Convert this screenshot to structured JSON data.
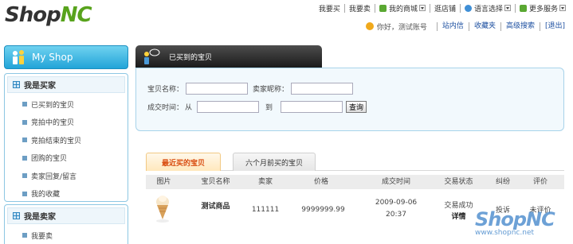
{
  "header": {
    "logo_shop": "Shop",
    "logo_nc": "NC",
    "topnav": [
      {
        "label": "我要买"
      },
      {
        "label": "我要卖"
      },
      {
        "label": "我的商城"
      },
      {
        "label": "逛店铺"
      },
      {
        "label": "语言选择"
      },
      {
        "label": "更多服务"
      }
    ],
    "greeting": "你好，测试账号",
    "links": [
      "站内信",
      "收藏夹",
      "高级搜索",
      "[退出]"
    ]
  },
  "sidebar": {
    "title": "My Shop",
    "buyer": {
      "heading": "我是买家",
      "items": [
        "已买到的宝贝",
        "竞拍中的宝贝",
        "竞拍结束的宝贝",
        "团购的宝贝",
        "卖家回复/留言",
        "我的收藏"
      ]
    },
    "seller": {
      "heading": "我是卖家",
      "items": [
        "我要卖"
      ]
    }
  },
  "main": {
    "title": "已买到的宝贝",
    "search": {
      "item_name_label": "宝贝名称：",
      "seller_label": "卖家昵称：",
      "time_label": "成交时间：",
      "from_label": "从",
      "to_label": "到",
      "query_button": "查询"
    },
    "tabs": [
      "最近买的宝贝",
      "六个月前买的宝贝"
    ],
    "table": {
      "headers": [
        "图片",
        "宝贝名称",
        "卖家",
        "价格",
        "成交时间",
        "交易状态",
        "纠纷",
        "评价"
      ],
      "row": {
        "name": "测试商品",
        "seller": "111111",
        "price": "9999999.99",
        "date": "2009-09-06",
        "time": "20:37",
        "status": "交易成功",
        "status_link": "详情",
        "dispute": "投诉",
        "rating": "未评价"
      }
    }
  },
  "watermark": {
    "brand": "ShopNC",
    "url": "www.shopnc.net"
  },
  "colors": {
    "brand_green": "#58a31c",
    "accent_blue": "#22a4d8",
    "tab_active": "#d84a0c",
    "link_blue": "#1c4fa0"
  }
}
